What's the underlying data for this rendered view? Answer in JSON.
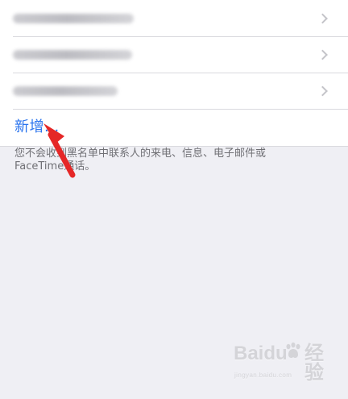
{
  "blocked_list": {
    "add_label": "新增...",
    "footnote": "您不会收到黑名单中联系人的来电、信息、电子邮件或\nFaceTime通话。"
  },
  "icons": {
    "chevron": "chevron-right-icon",
    "arrow": "red-arrow-icon",
    "watermark": "baidu-jingyan-logo"
  },
  "colors": {
    "accent": "#2b74ee",
    "background": "#efeff4",
    "arrow": "#e52727"
  },
  "watermark": {
    "brand": "Baidu",
    "product": "经验",
    "site": "jingyan.baidu.com"
  }
}
